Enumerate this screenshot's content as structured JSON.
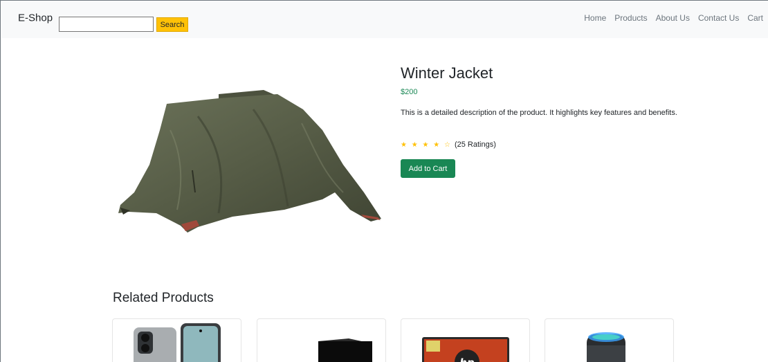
{
  "navbar": {
    "brand": "E-Shop",
    "search": {
      "placeholder": "",
      "value": "",
      "button_label": "Search"
    },
    "links": [
      "Home",
      "Products",
      "About Us",
      "Contact Us",
      "Cart"
    ]
  },
  "product": {
    "title": "Winter Jacket",
    "price": "$200",
    "description": "This is a detailed description of the product. It highlights key features and benefits.",
    "stars_display": "★ ★ ★ ★ ☆",
    "rating_value": 4,
    "rating_max": 5,
    "ratings_text": "(25 Ratings)",
    "add_to_cart_label": "Add to Cart"
  },
  "related": {
    "heading": "Related Products",
    "items": [
      {
        "image_icon": "smartphone-icon"
      },
      {
        "image_icon": "box-speaker-icon"
      },
      {
        "image_icon": "laptop-icon",
        "image_text": "hp"
      },
      {
        "image_icon": "portable-speaker-icon"
      }
    ]
  },
  "colors": {
    "accent_green": "#198754",
    "search_yellow": "#ffc107",
    "navbar_bg": "#f8f9fa",
    "star_color": "#ffc107"
  }
}
